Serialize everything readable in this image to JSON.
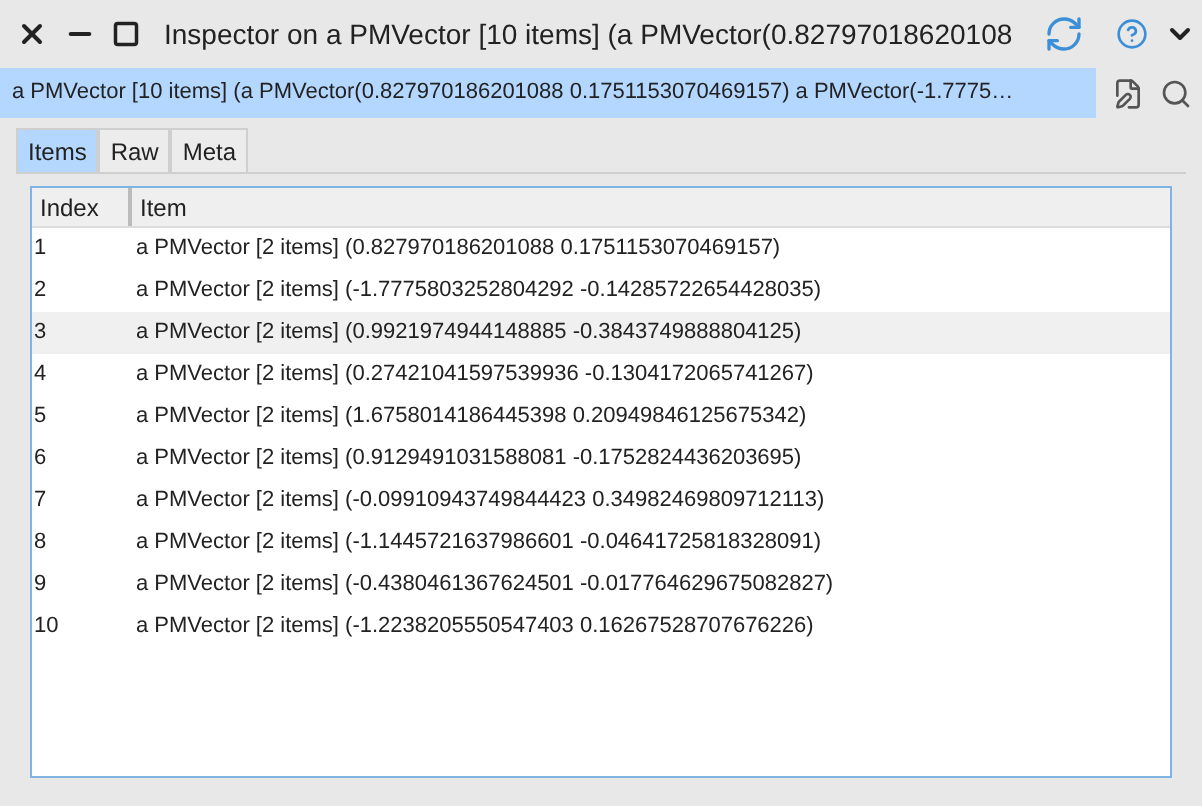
{
  "window": {
    "title": "Inspector on a PMVector [10 items] (a PMVector(0.82797018620108"
  },
  "breadcrumb": {
    "text": "a PMVector [10 items] (a PMVector(0.827970186201088 0.1751153070469157) a PMVector(-1.7775…"
  },
  "tabs": [
    {
      "label": "Items",
      "selected": true
    },
    {
      "label": "Raw",
      "selected": false
    },
    {
      "label": "Meta",
      "selected": false
    }
  ],
  "table": {
    "columns": [
      "Index",
      "Item"
    ],
    "rows": [
      {
        "index": "1",
        "item": "a PMVector [2 items] (0.827970186201088 0.1751153070469157)",
        "selected": false
      },
      {
        "index": "2",
        "item": "a PMVector [2 items] (-1.7775803252804292 -0.14285722654428035)",
        "selected": false
      },
      {
        "index": "3",
        "item": "a PMVector [2 items] (0.9921974944148885 -0.3843749888804125)",
        "selected": true
      },
      {
        "index": "4",
        "item": "a PMVector [2 items] (0.27421041597539936 -0.1304172065741267)",
        "selected": false
      },
      {
        "index": "5",
        "item": "a PMVector [2 items] (1.6758014186445398 0.20949846125675342)",
        "selected": false
      },
      {
        "index": "6",
        "item": "a PMVector [2 items] (0.9129491031588081 -0.1752824436203695)",
        "selected": false
      },
      {
        "index": "7",
        "item": "a PMVector [2 items] (-0.09910943749844423 0.34982469809712113)",
        "selected": false
      },
      {
        "index": "8",
        "item": "a PMVector [2 items] (-1.1445721637986601 -0.04641725818328091)",
        "selected": false
      },
      {
        "index": "9",
        "item": "a PMVector [2 items] (-0.4380461367624501 -0.017764629675082827)",
        "selected": false
      },
      {
        "index": "10",
        "item": "a PMVector [2 items] (-1.2238205550547403 0.16267528707676226)",
        "selected": false
      }
    ]
  }
}
